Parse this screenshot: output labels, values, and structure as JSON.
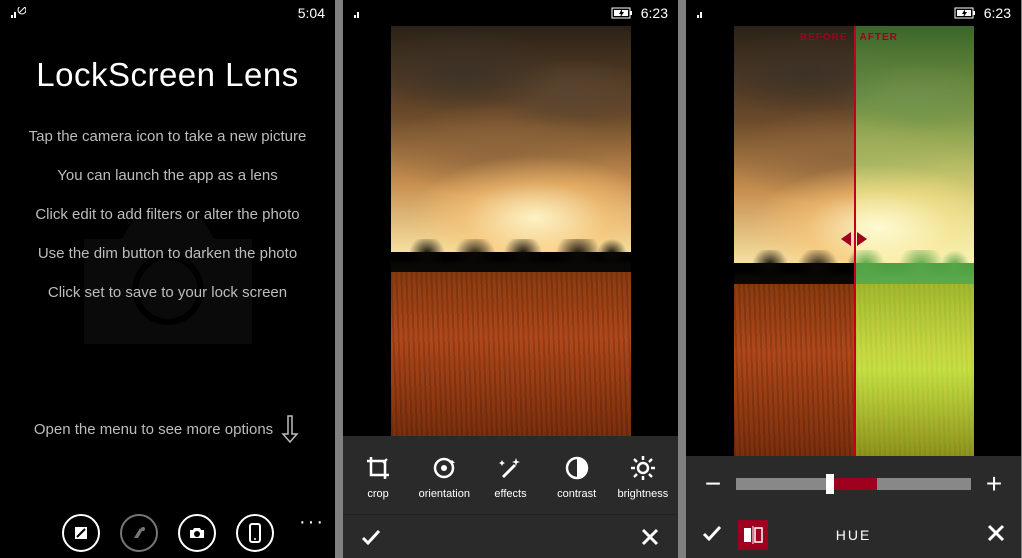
{
  "screen1": {
    "status": {
      "time": "5:04"
    },
    "title": "LockScreen Lens",
    "instructions": [
      "Tap the camera icon to take a new picture",
      "You can launch the app as a lens",
      "Click edit to add filters or alter the photo",
      "Use the dim button to darken the photo",
      "Click set to save to your lock screen"
    ],
    "bottom_hint": "Open the menu to see more options",
    "appbar": {
      "buttons": [
        "edit",
        "dim",
        "camera",
        "set"
      ],
      "ellipsis": "···"
    }
  },
  "screen2": {
    "status": {
      "time": "6:23"
    },
    "tools": [
      {
        "id": "crop",
        "label": "crop"
      },
      {
        "id": "orientation",
        "label": "orientation"
      },
      {
        "id": "effects",
        "label": "effects"
      },
      {
        "id": "contrast",
        "label": "contrast"
      },
      {
        "id": "brightness",
        "label": "brightness"
      }
    ]
  },
  "screen3": {
    "status": {
      "time": "6:23"
    },
    "before_label": "BEFORE",
    "after_label": "AFTER",
    "slider": {
      "minus": "−",
      "plus": "+",
      "value_pct": 40
    },
    "mode_label": "HUE"
  }
}
